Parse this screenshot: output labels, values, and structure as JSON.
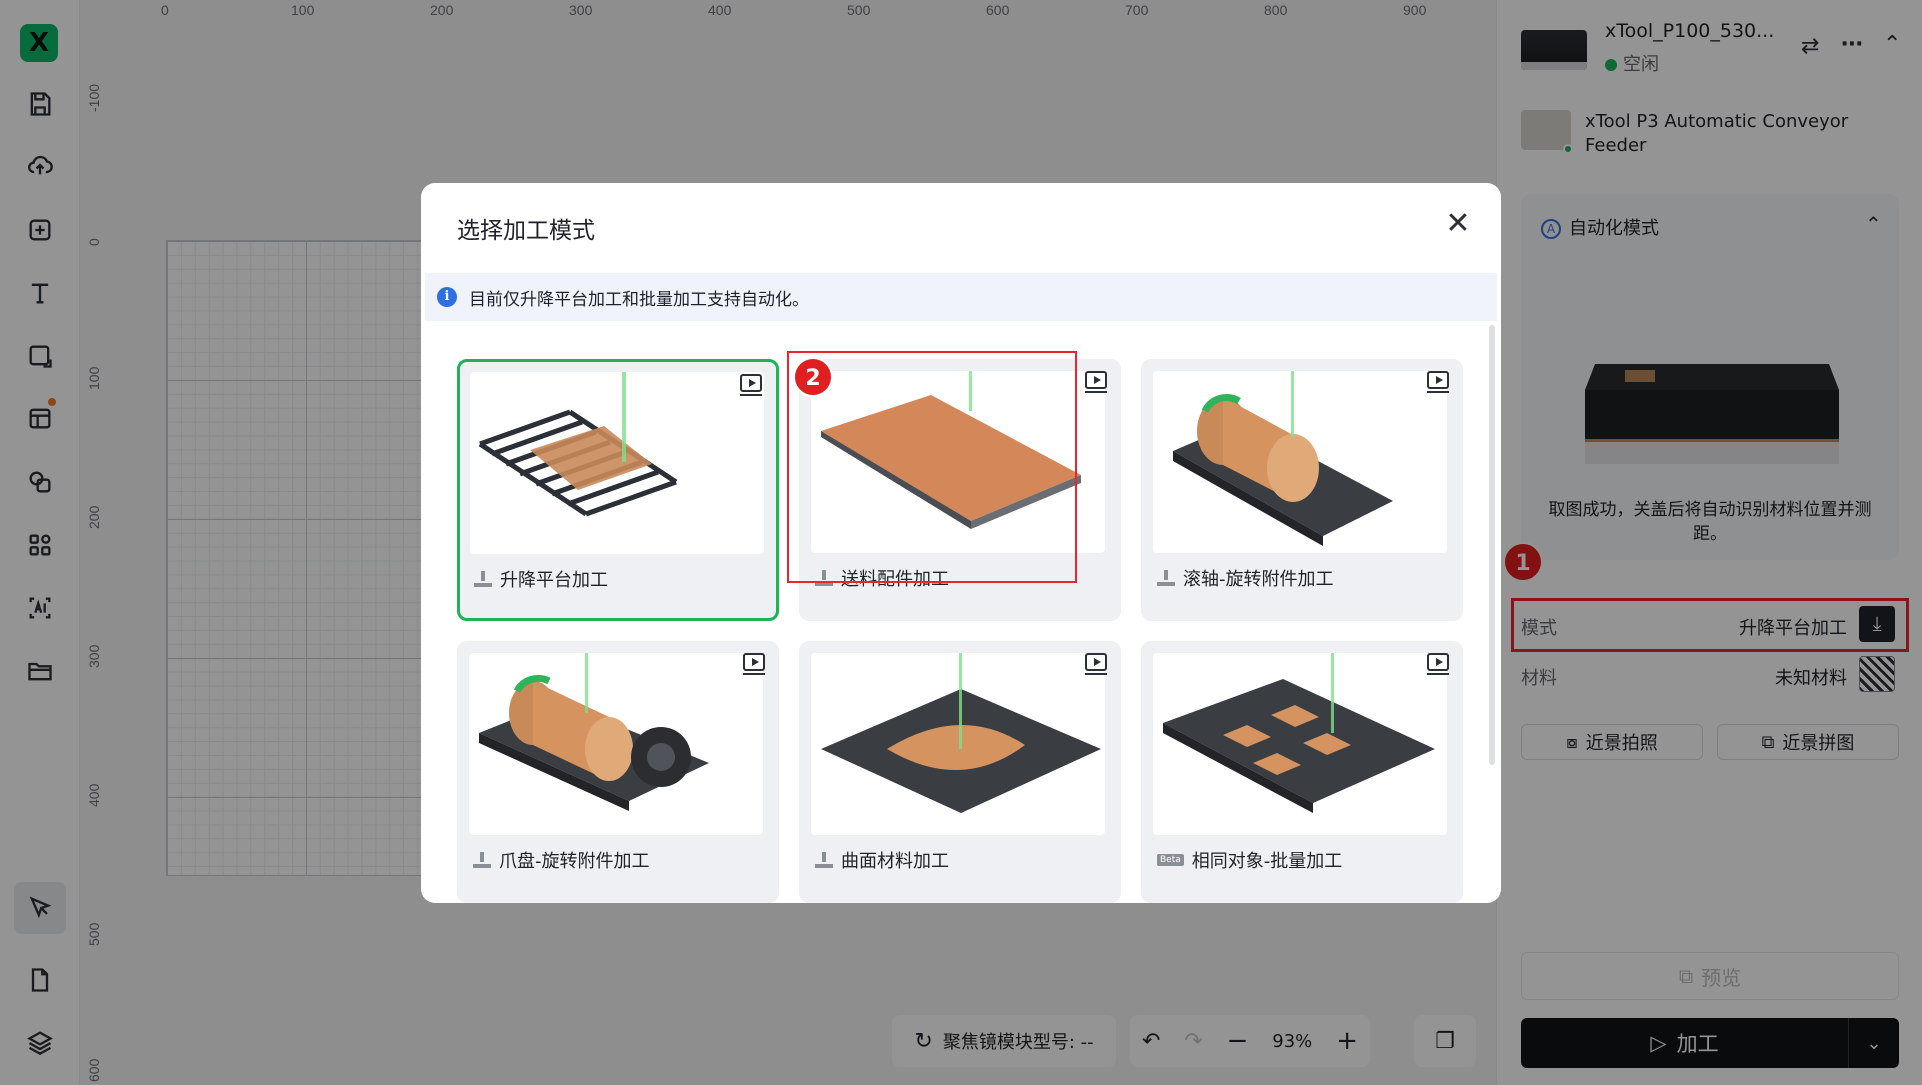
{
  "app": {
    "logo_text": "X"
  },
  "toolbar": {
    "tools": [
      "save-icon",
      "cloud-upload-icon",
      "add-icon",
      "text-icon",
      "shape-icon",
      "layout-icon",
      "shape-combine-icon",
      "apps-icon",
      "ai-icon",
      "folder-icon",
      "select-pointer-icon",
      "document-icon",
      "layers-icon"
    ]
  },
  "ruler": {
    "top": [
      "0",
      "100",
      "200",
      "300",
      "400",
      "500",
      "600",
      "700",
      "800",
      "900"
    ],
    "left": [
      "-100",
      "0",
      "100",
      "200",
      "300",
      "400",
      "500",
      "600"
    ]
  },
  "bottom_bar": {
    "focus_module": "聚焦镜模块型号: --",
    "zoom": "93%"
  },
  "right_panel": {
    "device": {
      "name": "xTool_P100_530...",
      "status": "空闲"
    },
    "accessory": {
      "name": "xTool P3 Automatic Conveyor Feeder"
    },
    "auto_mode": {
      "title": "自动化模式",
      "message": "取图成功，关盖后将自动识别材料位置并测距。"
    },
    "mode": {
      "label": "模式",
      "value": "升降平台加工"
    },
    "material": {
      "label": "材料",
      "value": "未知材料"
    },
    "closeup_photo": "近景拍照",
    "closeup_stitch": "近景拼图",
    "preview": "预览",
    "process": "加工",
    "badge_1": "1"
  },
  "modal": {
    "title": "选择加工模式",
    "info": "目前仅升降平台加工和批量加工支持自动化。",
    "badge_2": "2",
    "cards": [
      {
        "label": "升降平台加工",
        "selected": true
      },
      {
        "label": "送料配件加工",
        "selected": false
      },
      {
        "label": "滚轴-旋转附件加工",
        "selected": false
      },
      {
        "label": "爪盘-旋转附件加工",
        "selected": false
      },
      {
        "label": "曲面材料加工",
        "selected": false
      },
      {
        "label": "相同对象-批量加工",
        "selected": false,
        "beta": "Beta"
      }
    ]
  },
  "colors": {
    "accent_green": "#1cb35b",
    "highlight_red": "#e8262f",
    "info_blue": "#2f6fe4"
  }
}
